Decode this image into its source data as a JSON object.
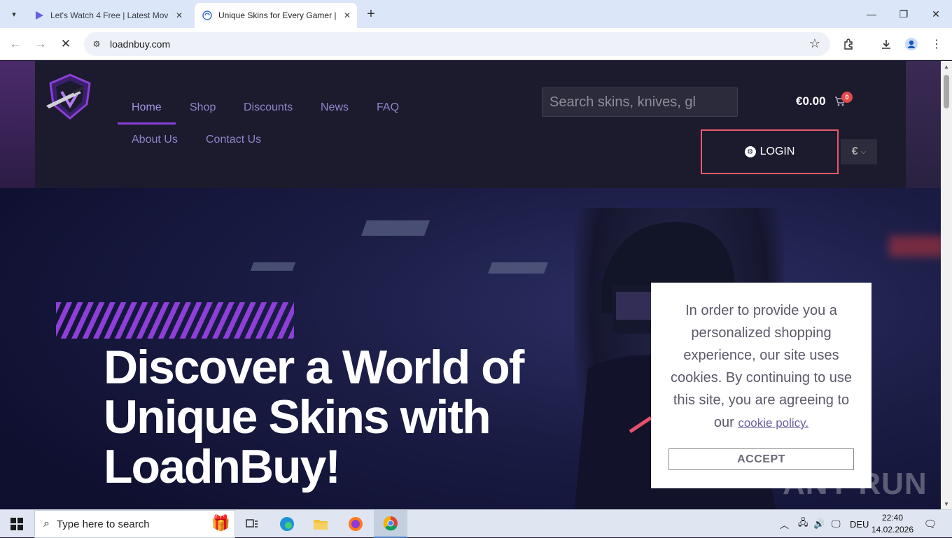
{
  "browser": {
    "tabs": [
      {
        "title": "Let's Watch 4 Free | Latest Mov",
        "favicon": "play-icon"
      },
      {
        "title": "Unique Skins for Every Gamer |",
        "favicon": "globe-icon"
      }
    ],
    "address": "loadnbuy.com"
  },
  "site": {
    "nav": [
      "Home",
      "Shop",
      "Discounts",
      "News",
      "FAQ",
      "About Us",
      "Contact Us"
    ],
    "search_placeholder": "Search skins, knives, gl",
    "cart_total": "€0.00",
    "cart_count": "0",
    "login_label": "LOGIN",
    "currency": "€",
    "hero_title": "Discover a World of Unique Skins with LoadnBuy!"
  },
  "cookie": {
    "message": "In order to provide you a personalized shopping experience, our site uses cookies. By continuing to use this site, you are agreeing to our",
    "link": "cookie policy.",
    "accept": "ACCEPT"
  },
  "watermark": "ANY RUN",
  "taskbar": {
    "search_placeholder": "Type here to search",
    "language": "DEU",
    "time": "22:40",
    "date": "14.02.2026"
  },
  "colors": {
    "accent_purple": "#8a3fd6",
    "login_border": "#e85a6a",
    "cart_badge": "#e34b4b"
  }
}
